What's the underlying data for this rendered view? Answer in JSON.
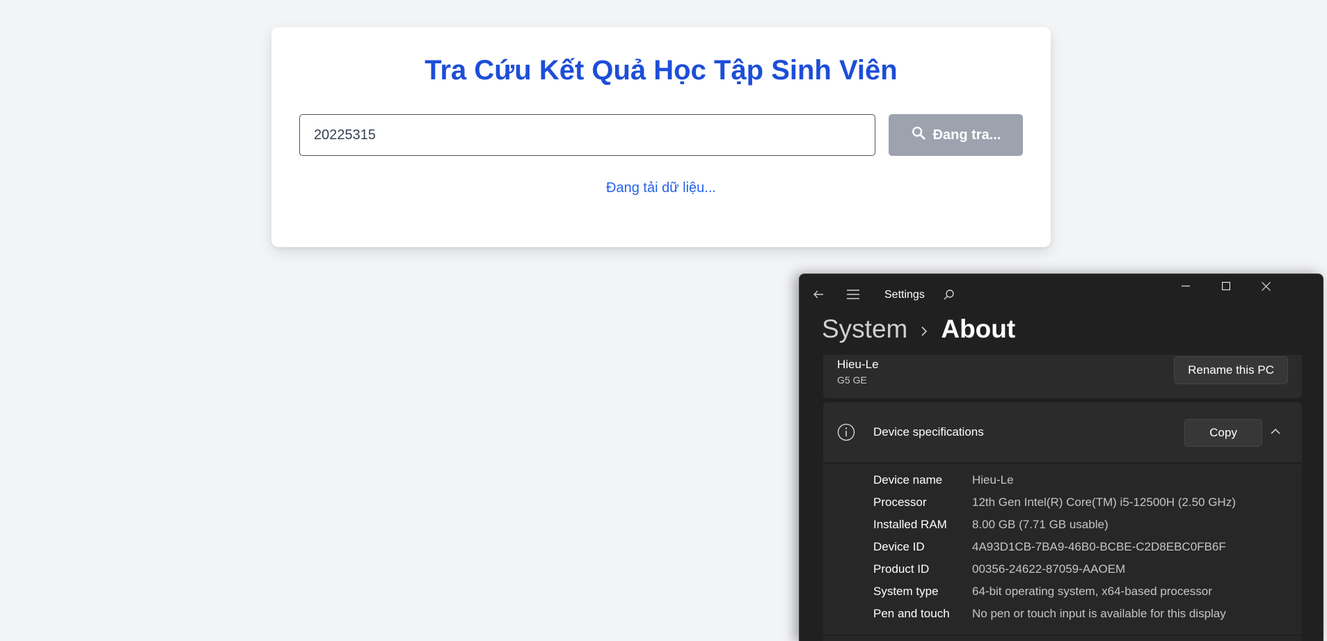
{
  "web": {
    "title": "Tra Cứu Kết Quả Học Tập Sinh Viên",
    "search_value": "20225315",
    "search_button_label": "Đang tra...",
    "loading_text": "Đang tải dữ liệu...",
    "accent_color": "#1d4ed8",
    "button_color_disabled": "#9ca3af"
  },
  "settings": {
    "window_title": "Settings",
    "breadcrumb": {
      "parent": "System",
      "current": "About"
    },
    "pc": {
      "name": "Hieu-Le",
      "model": "G5 GE",
      "rename_label": "Rename this PC"
    },
    "device_specs": {
      "title": "Device specifications",
      "copy_label": "Copy",
      "rows": [
        {
          "label": "Device name",
          "value": "Hieu-Le"
        },
        {
          "label": "Processor",
          "value": "12th Gen Intel(R) Core(TM) i5-12500H (2.50 GHz)"
        },
        {
          "label": "Installed RAM",
          "value": "8.00 GB (7.71 GB usable)"
        },
        {
          "label": "Device ID",
          "value": "4A93D1CB-7BA9-46B0-BCBE-C2D8EBC0FB6F"
        },
        {
          "label": "Product ID",
          "value": "00356-24622-87059-AAOEM"
        },
        {
          "label": "System type",
          "value": "64-bit operating system, x64-based processor"
        },
        {
          "label": "Pen and touch",
          "value": "No pen or touch input is available for this display"
        }
      ]
    },
    "icons": [
      "back-arrow-icon",
      "hamburger-menu-icon",
      "search-icon",
      "minimize-icon",
      "maximize-icon",
      "close-icon",
      "info-icon",
      "chevron-up-icon",
      "chevron-right-icon"
    ]
  }
}
